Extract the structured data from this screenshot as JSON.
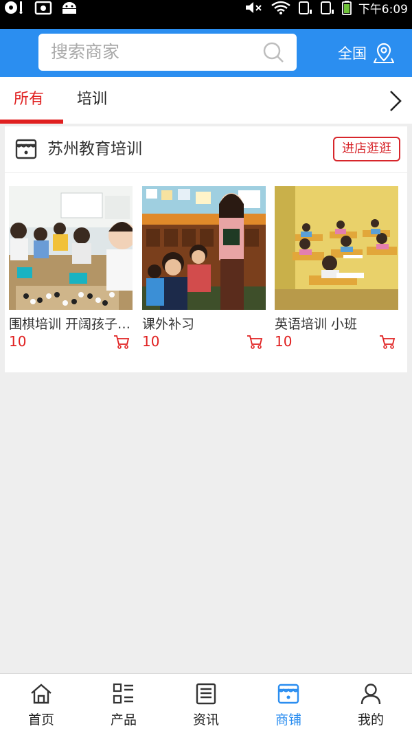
{
  "status_bar": {
    "time": "下午6:09"
  },
  "header": {
    "search_placeholder": "搜索商家",
    "region_label": "全国"
  },
  "tabs": [
    {
      "label": "所有",
      "active": true
    },
    {
      "label": "培训",
      "active": false
    }
  ],
  "shop": {
    "name": "苏州教育培训",
    "enter_label": "进店逛逛",
    "products": [
      {
        "name": "围棋培训 开阔孩子视野",
        "price": "10"
      },
      {
        "name": "课外补习",
        "price": "10"
      },
      {
        "name": "英语培训 小班",
        "price": "10"
      }
    ]
  },
  "bottom_nav": [
    {
      "label": "首页",
      "icon": "home-icon",
      "active": false
    },
    {
      "label": "产品",
      "icon": "list-icon",
      "active": false
    },
    {
      "label": "资讯",
      "icon": "news-icon",
      "active": false
    },
    {
      "label": "商铺",
      "icon": "store-icon",
      "active": true
    },
    {
      "label": "我的",
      "icon": "user-icon",
      "active": false
    }
  ],
  "colors": {
    "primary": "#2b8ef0",
    "accent_red": "#e02020",
    "background": "#eeeeee"
  }
}
